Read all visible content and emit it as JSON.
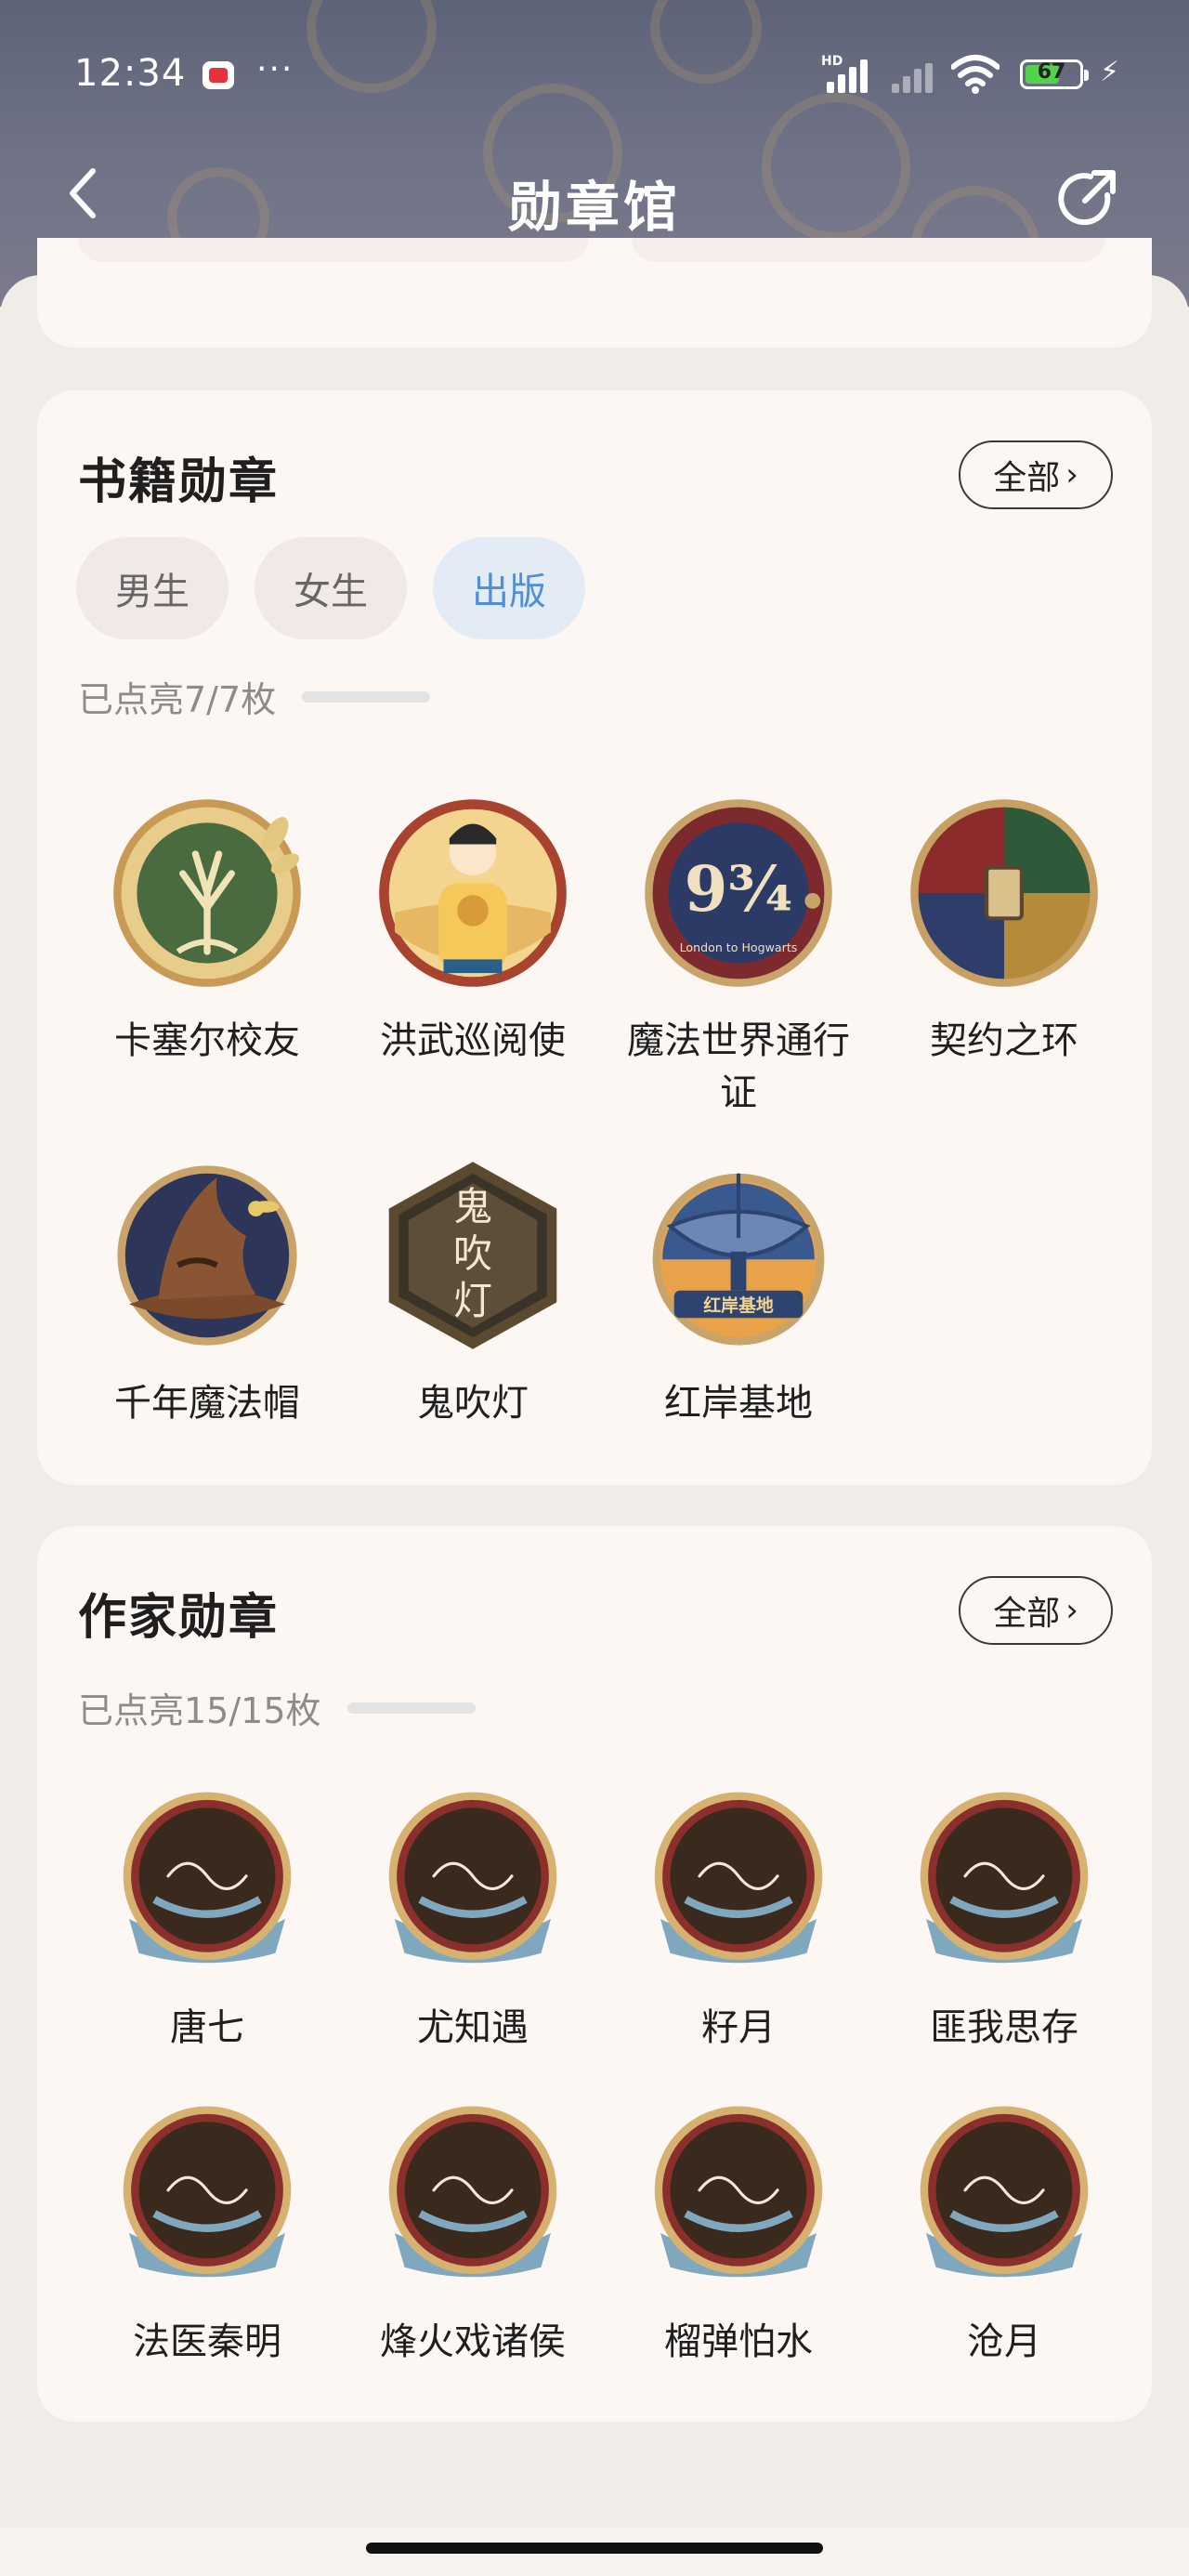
{
  "status_bar": {
    "time": "12:34",
    "more": "···",
    "battery": "67",
    "network_label": "HD"
  },
  "header": {
    "title": "勋章馆"
  },
  "book_section": {
    "title": "书籍勋章",
    "all_label": "全部",
    "tabs": [
      {
        "label": "男生",
        "active": false
      },
      {
        "label": "女生",
        "active": false
      },
      {
        "label": "出版",
        "active": true
      }
    ],
    "progress_text": "已点亮7/7枚",
    "progress_fraction": 1.0,
    "badges": [
      {
        "name": "卡塞尔校友",
        "icon": "tree-emblem-badge"
      },
      {
        "name": "洪武巡阅使",
        "icon": "emperor-badge"
      },
      {
        "name": "魔法世界通行证",
        "icon": "platform-nine-three-quarters-badge",
        "emblem_text": "9¾",
        "sub_text": "London to Hogwarts"
      },
      {
        "name": "契约之环",
        "icon": "quartered-crest-badge"
      },
      {
        "name": "千年魔法帽",
        "icon": "sorting-hat-badge"
      },
      {
        "name": "鬼吹灯",
        "icon": "ghost-lamp-badge",
        "emblem_text": "鬼吹灯"
      },
      {
        "name": "红岸基地",
        "icon": "radar-dish-badge",
        "emblem_text": "红岸基地"
      }
    ]
  },
  "writer_section": {
    "title": "作家勋章",
    "all_label": "全部",
    "progress_text": "已点亮15/15枚",
    "progress_fraction": 1.0,
    "badges": [
      {
        "name": "唐七",
        "icon": "signature-badge"
      },
      {
        "name": "尤知遇",
        "icon": "signature-badge"
      },
      {
        "name": "籽月",
        "icon": "signature-badge"
      },
      {
        "name": "匪我思存",
        "icon": "signature-badge"
      },
      {
        "name": "法医秦明",
        "icon": "signature-badge"
      },
      {
        "name": "烽火戏诸侯",
        "icon": "signature-badge"
      },
      {
        "name": "榴弹怕水",
        "icon": "signature-badge"
      },
      {
        "name": "沧月",
        "icon": "signature-badge"
      }
    ]
  },
  "colors": {
    "accent_blue": "#4f93e2",
    "card_bg": "#fdf7f4",
    "page_bg": "#f2ece9",
    "header_bg": "#666a7e",
    "badge_gold": "#d7b170"
  }
}
